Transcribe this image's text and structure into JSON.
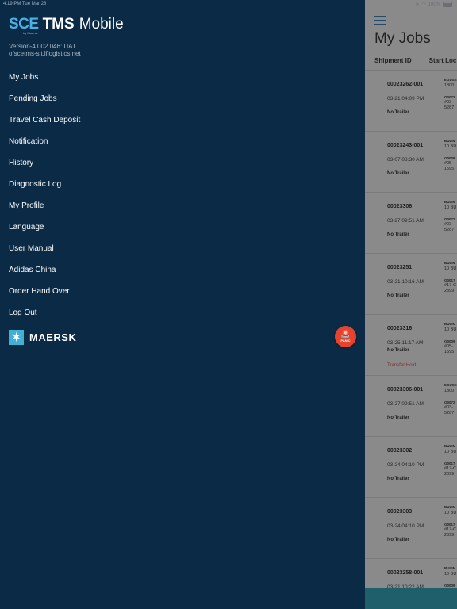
{
  "status_bar": {
    "time": "4:19 PM",
    "date": "Tue Mar 28",
    "battery": "100%"
  },
  "app": {
    "logo_sce": "SCE",
    "logo_by": "by Maersk",
    "logo_tms": "TMS",
    "logo_mobile": "Mobile",
    "version": "Version-4.002.046: UAT",
    "host": "ofscetms-sit.lflogistics.net"
  },
  "menu": {
    "items": [
      {
        "label": "My Jobs"
      },
      {
        "label": "Pending Jobs"
      },
      {
        "label": "Travel Cash Deposit"
      },
      {
        "label": "Notification"
      },
      {
        "label": "History"
      },
      {
        "label": "Diagnostic Log"
      },
      {
        "label": "My Profile"
      },
      {
        "label": "Language"
      },
      {
        "label": "User Manual"
      },
      {
        "label": "Adidas China"
      },
      {
        "label": "Order Hand Over"
      },
      {
        "label": "Log Out"
      }
    ]
  },
  "brand": {
    "name": "MAERSK",
    "color": "#42b0d5"
  },
  "panic": {
    "label": "PANIC",
    "color": "#e5432d"
  },
  "jobs": {
    "title": "My Jobs",
    "columns": [
      "Shipment ID",
      "Start Loc"
    ],
    "rows": [
      {
        "id": "00023262-001",
        "date": "03-21 04:09 PM",
        "trailer": "No Trailer",
        "loc1": "EGUSE",
        "loc2": "1800",
        "loc3": "G0072",
        "loc4": "#03-",
        "loc5": "5287"
      },
      {
        "id": "00023243-001",
        "date": "03-07 08:30 AM",
        "trailer": "No Trailer",
        "loc1": "BULIM",
        "loc2": "10 BU",
        "loc3": "G0009",
        "loc4": "#05-",
        "loc5": "1595"
      },
      {
        "id": "00023306",
        "date": "03-27 09:51 AM",
        "trailer": "No Trailer",
        "loc1": "BULIM",
        "loc2": "10 BU",
        "loc3": "G0072",
        "loc4": "#03-",
        "loc5": "5287"
      },
      {
        "id": "00023251",
        "date": "03-21 10:16 AM",
        "trailer": "No Trailer",
        "loc1": "BULIM",
        "loc2": "10 BU",
        "loc3": "G0017",
        "loc4": "#17-C",
        "loc5": "2399"
      },
      {
        "id": "00023316",
        "date": "03-25 11:17 AM",
        "trailer": "No Trailer",
        "hold": "Transfer Hold",
        "loc1": "BULIM",
        "loc2": "10 BU",
        "loc3": "G0009",
        "loc4": "#05-",
        "loc5": "1595"
      },
      {
        "id": "00023306-001",
        "date": "03-27 09:51 AM",
        "trailer": "No Trailer",
        "loc1": "EGUSE",
        "loc2": "1800",
        "loc3": "G0072",
        "loc4": "#03-",
        "loc5": "5287"
      },
      {
        "id": "00023302",
        "date": "03-24 04:10 PM",
        "trailer": "No Trailer",
        "loc1": "BULIM",
        "loc2": "10 BU",
        "loc3": "G0017",
        "loc4": "#17-C",
        "loc5": "2399"
      },
      {
        "id": "00023303",
        "date": "03-24 04:10 PM",
        "trailer": "No Trailer",
        "loc1": "BULIM",
        "loc2": "10 BU",
        "loc3": "G0017",
        "loc4": "#17-C",
        "loc5": "2399"
      },
      {
        "id": "00023258-001",
        "date": "03-21 10:22 AM",
        "trailer": "",
        "loc1": "BULIM",
        "loc2": "10 BU",
        "loc3": "G0009",
        "loc4": "",
        "loc5": ""
      }
    ]
  }
}
